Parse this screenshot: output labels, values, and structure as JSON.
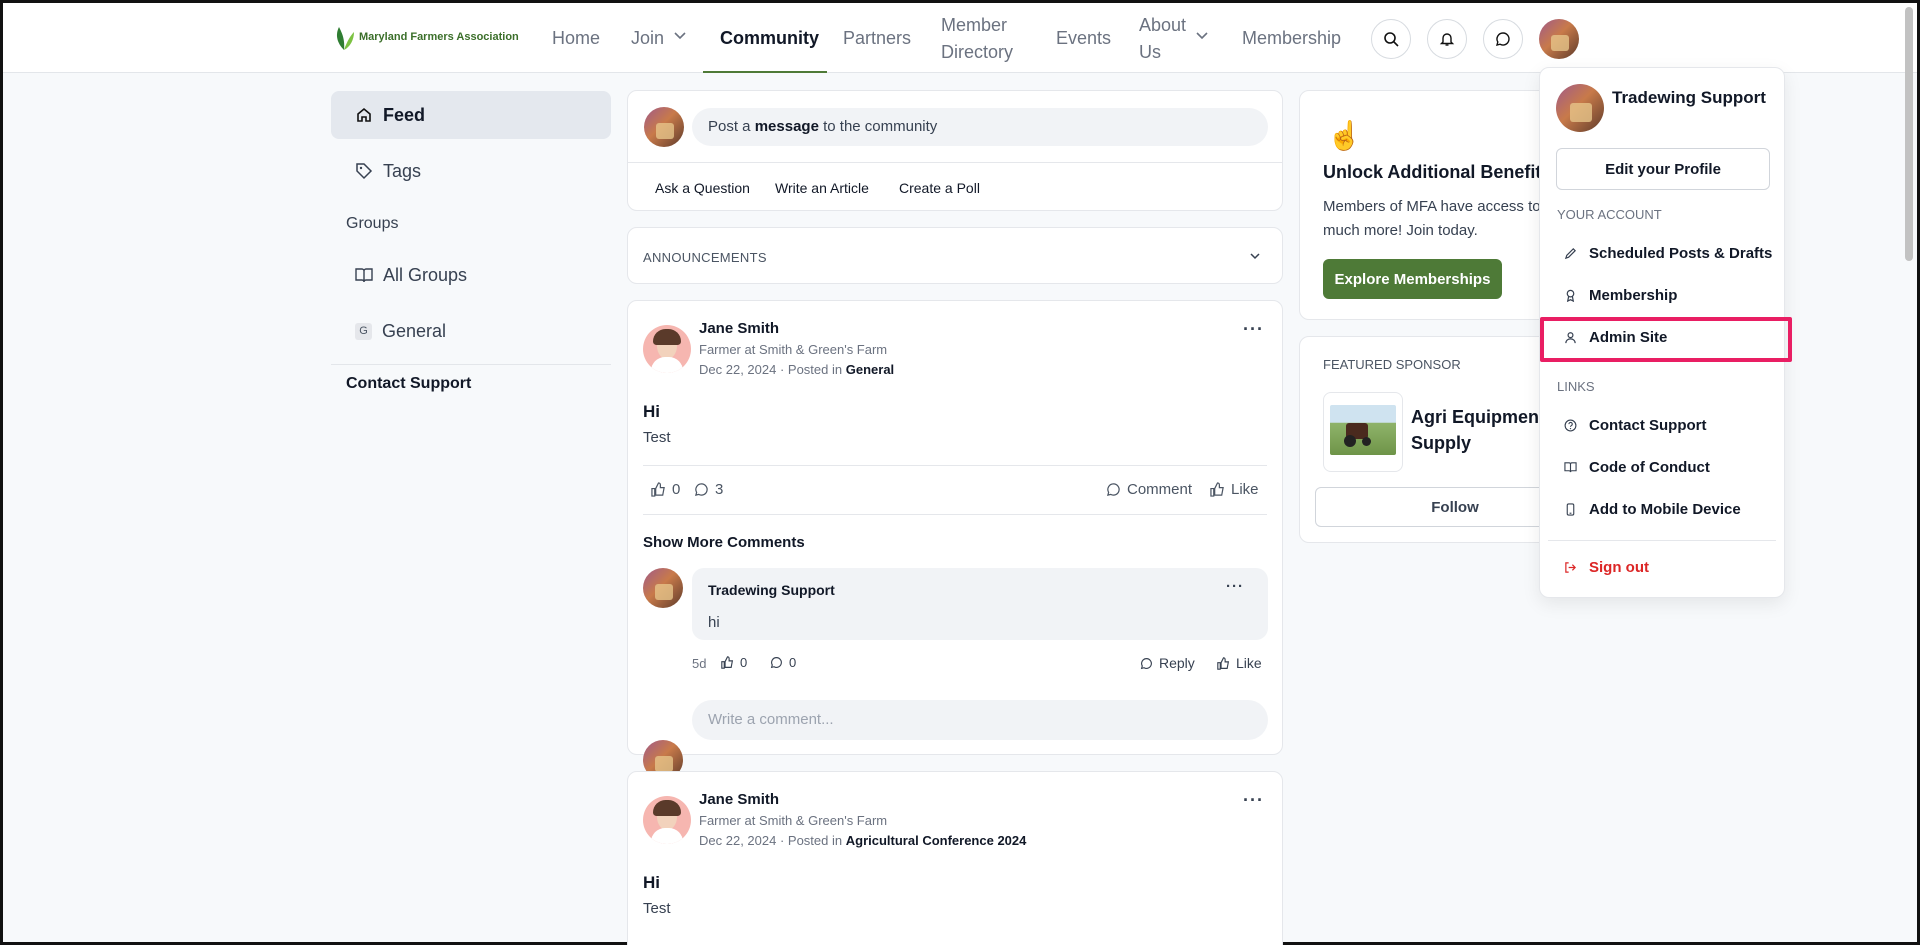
{
  "header": {
    "logo_text": "Maryland Farmers Association",
    "nav": {
      "home": "Home",
      "join": "Join",
      "community": "Community",
      "partners": "Partners",
      "member_directory_1": "Member",
      "member_directory_2": "Directory",
      "events": "Events",
      "about_1": "About",
      "about_2": "Us",
      "membership": "Membership"
    }
  },
  "sidebar": {
    "feed": "Feed",
    "tags": "Tags",
    "groups_heading": "Groups",
    "all_groups": "All Groups",
    "general": "General",
    "general_badge": "G",
    "contact_support": "Contact Support"
  },
  "composer": {
    "prefix": "Post a",
    "bold": "message",
    "suffix": "to the community",
    "ask_question": "Ask a Question",
    "write_article": "Write an Article",
    "create_poll": "Create a Poll"
  },
  "announcements": {
    "label": "ANNOUNCEMENTS"
  },
  "posts": [
    {
      "author": "Jane Smith",
      "role": "Farmer at Smith & Green's Farm",
      "date": "Dec 22, 2024",
      "posted_in_prefix": "· Posted in",
      "group": "General",
      "title": "Hi",
      "text": "Test",
      "likes": "0",
      "comments": "3",
      "comment_label": "Comment",
      "like_label": "Like",
      "show_more": "Show More Comments",
      "reply": {
        "author": "Tradewing Support",
        "text": "hi",
        "age": "5d",
        "likes": "0",
        "comments": "0",
        "reply_label": "Reply",
        "like_label": "Like"
      },
      "comment_placeholder": "Write a comment..."
    },
    {
      "author": "Jane Smith",
      "role": "Farmer at Smith & Green's Farm",
      "date": "Dec 22, 2024",
      "posted_in_prefix": "· Posted in",
      "group": "Agricultural Conference 2024",
      "title": "Hi",
      "text": "Test"
    }
  ],
  "benefits": {
    "emoji": "☝",
    "title": "Unlock Additional Benefits",
    "text_1": "Members of MFA have access to s",
    "text_2": "much more! Join today.",
    "button": "Explore Memberships"
  },
  "sponsor": {
    "heading": "FEATURED SPONSOR",
    "name_1": "Agri Equipment",
    "name_2": "Supply",
    "follow": "Follow"
  },
  "dropdown": {
    "user": "Tradewing Support",
    "edit_profile": "Edit your Profile",
    "your_account": "YOUR ACCOUNT",
    "scheduled": "Scheduled Posts & Drafts",
    "membership": "Membership",
    "admin_site": "Admin Site",
    "links": "LINKS",
    "contact_support": "Contact Support",
    "code_of_conduct": "Code of Conduct",
    "add_mobile": "Add to Mobile Device",
    "sign_out": "Sign out"
  },
  "colors": {
    "brand_green": "#4e7a37",
    "highlight": "#e91e63",
    "sign_out": "#dc2626"
  }
}
